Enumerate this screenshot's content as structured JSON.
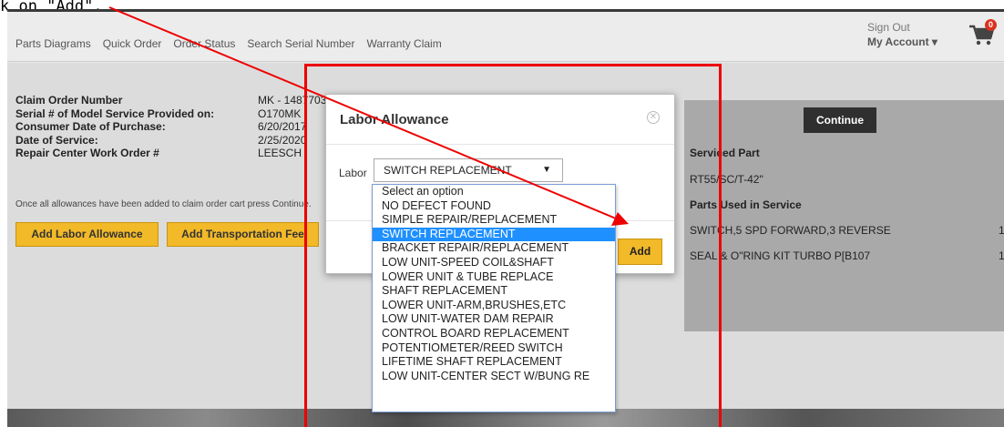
{
  "instruction": "k on \"Add\".",
  "nav": {
    "links": [
      "Parts Diagrams",
      "Quick Order",
      "Order Status",
      "Search Serial Number",
      "Warranty Claim"
    ],
    "sign_out": "Sign Out",
    "my_account": "My Account ▾",
    "cart_count": "0"
  },
  "claim": {
    "rows": [
      {
        "label": "Claim Order Number",
        "value": "MK - 1487703"
      },
      {
        "label": "Serial # of Model Service Provided on:",
        "value": "O170MK"
      },
      {
        "label": "Consumer Date of Purchase:",
        "value": "6/20/2017"
      },
      {
        "label": "Date of Service:",
        "value": "2/25/2020"
      },
      {
        "label": "Repair Center Work Order #",
        "value": "LEESCH"
      }
    ],
    "note": "Once all allowances have been added to claim order cart press Continue.",
    "add_labor_btn": "Add Labor Allowance",
    "add_transport_btn": "Add Transportation Fee"
  },
  "summary": {
    "continue_btn": "Continue",
    "serviced_part_heading": "Serviced Part",
    "serviced_part": "RT55/SC/T-42\"",
    "parts_used_heading": "Parts Used in Service",
    "parts": [
      {
        "name": "SWITCH,5 SPD FORWARD,3 REVERSE",
        "qty": "1"
      },
      {
        "name": "SEAL & O\"RING KIT TURBO P[B107",
        "qty": "1"
      }
    ]
  },
  "modal": {
    "title": "Labor Allowance",
    "close_icon": "✕",
    "labor_label": "Labor",
    "selected_value": "SWITCH REPLACEMENT",
    "add_btn": "Add"
  },
  "dropdown": {
    "options": [
      "Select an option",
      "NO DEFECT FOUND",
      "SIMPLE REPAIR/REPLACEMENT",
      "SWITCH REPLACEMENT",
      "BRACKET REPAIR/REPLACEMENT",
      "LOW UNIT-SPEED COIL&SHAFT",
      "LOWER UNIT & TUBE REPLACE",
      "SHAFT REPLACEMENT",
      "LOWER UNIT-ARM,BRUSHES,ETC",
      "LOW UNIT-WATER DAM REPAIR",
      "CONTROL BOARD REPLACEMENT",
      "POTENTIOMETER/REED SWITCH",
      "LIFETIME SHAFT REPLACEMENT",
      "LOW UNIT-CENTER SECT W/BUNG RE"
    ],
    "selected_index": 3
  },
  "colors": {
    "accent_yellow": "#f2b928",
    "highlight_red": "#ee0000",
    "selected_blue": "#1e90ff"
  }
}
